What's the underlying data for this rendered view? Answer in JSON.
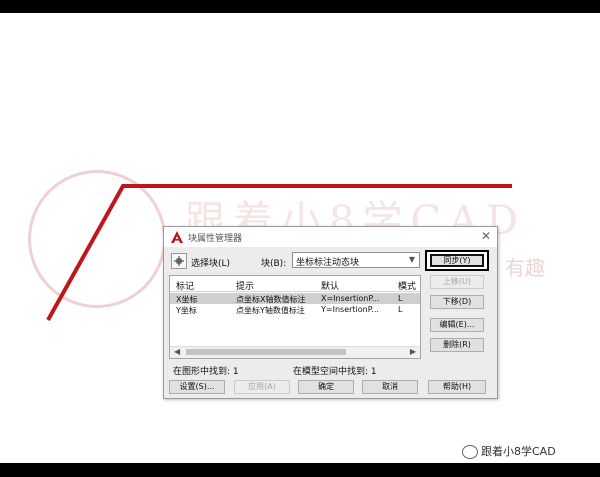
{
  "dialog": {
    "title": "块属性管理器",
    "select_block_label": "选择块(L)",
    "block_label": "块(B):",
    "block_value": "坐标标注动态块",
    "close_glyph": "✕"
  },
  "table": {
    "headers": [
      "标记",
      "提示",
      "默认",
      "模式"
    ],
    "rows": [
      {
        "tag": "X坐标",
        "prompt": "点坐标X轴数值标注",
        "default": "X=InsertionP...",
        "mode": "L"
      },
      {
        "tag": "Y坐标",
        "prompt": "点坐标Y轴数值标注",
        "default": "Y=InsertionP...",
        "mode": "L"
      }
    ]
  },
  "status": {
    "found_in_drawing": "在图形中找到: 1",
    "found_in_model": "在模型空间中找到: 1"
  },
  "buttons": {
    "sync": "同步(Y)",
    "move_up": "上移(U)",
    "move_down": "下移(D)",
    "edit": "编辑(E)...",
    "remove": "删除(R)",
    "settings": "设置(S)...",
    "apply": "应用(A)",
    "ok": "确定",
    "cancel": "取消",
    "help": "帮助(H)"
  },
  "watermark": {
    "brand": "跟着小8学CAD",
    "tagline": "有趣",
    "footer": "跟着小8学CAD"
  },
  "colors": {
    "accent_red": "#c0161b",
    "dialog_bg": "#ececec"
  }
}
